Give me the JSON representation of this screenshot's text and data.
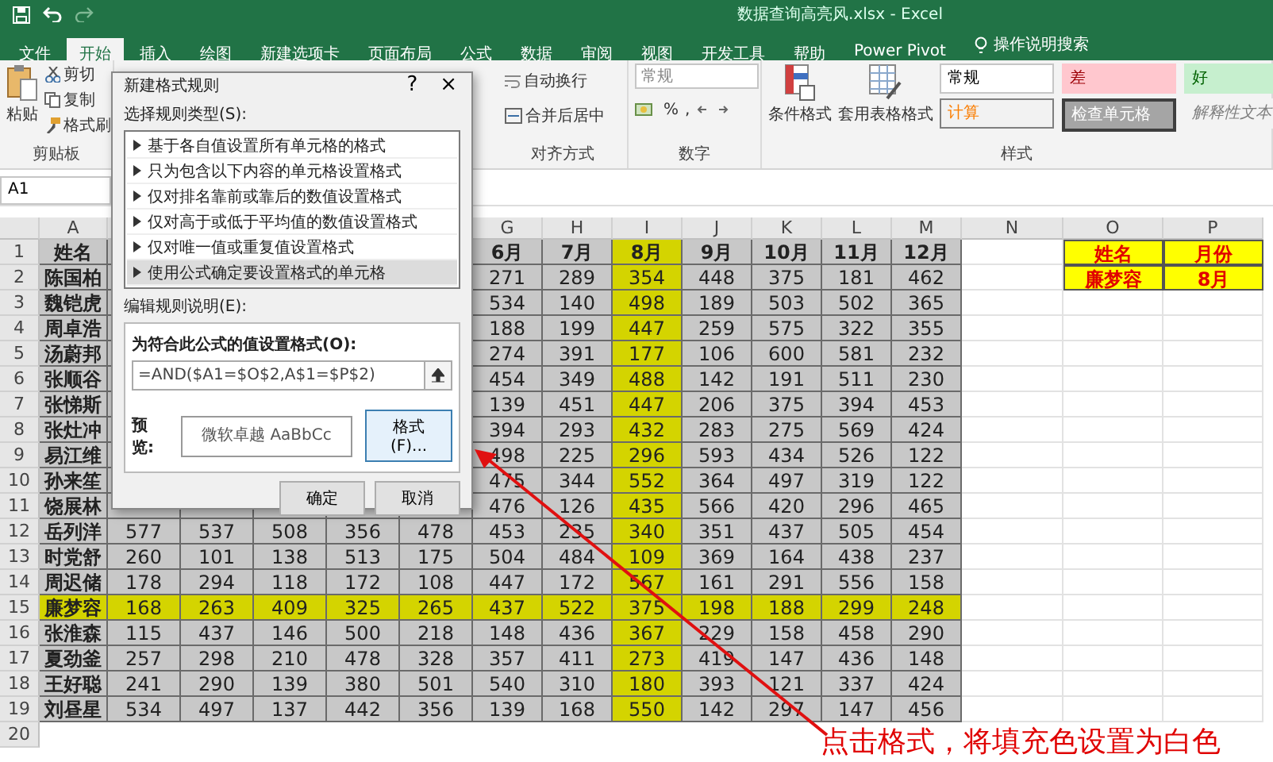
{
  "title_bar": {
    "filename": "数据查询高亮风.xlsx - Excel"
  },
  "tabs": [
    {
      "label": "文件",
      "selected": false
    },
    {
      "label": "开始",
      "selected": true
    },
    {
      "label": "插入",
      "selected": false
    },
    {
      "label": "绘图",
      "selected": false
    },
    {
      "label": "新建选项卡",
      "selected": false
    },
    {
      "label": "页面布局",
      "selected": false
    },
    {
      "label": "公式",
      "selected": false
    },
    {
      "label": "数据",
      "selected": false
    },
    {
      "label": "审阅",
      "selected": false
    },
    {
      "label": "视图",
      "selected": false
    },
    {
      "label": "开发工具",
      "selected": false
    },
    {
      "label": "帮助",
      "selected": false
    },
    {
      "label": "Power Pivot",
      "selected": false
    }
  ],
  "tell_me": "操作说明搜索",
  "ribbon": {
    "clipboard": {
      "paste": "粘贴",
      "cut": "剪切",
      "copy": "复制",
      "format_painter": "格式刷",
      "label": "剪贴板"
    },
    "alignment": {
      "wrap": "自动换行",
      "merge": "合并后居中",
      "label": "对齐方式"
    },
    "number": {
      "format": "常规",
      "percent": "%",
      "comma": ",",
      "label": "数字"
    },
    "styles": {
      "conditional": "条件格式",
      "table": "套用表格格式",
      "label": "样式",
      "cell_styles": [
        {
          "label": "常规",
          "kind": "normal"
        },
        {
          "label": "差",
          "kind": "bad"
        },
        {
          "label": "好",
          "kind": "good"
        },
        {
          "label": "计算",
          "kind": "calc"
        },
        {
          "label": "检查单元格",
          "kind": "check"
        },
        {
          "label": "解释性文本",
          "kind": "explanatory"
        }
      ]
    }
  },
  "name_box": "A1",
  "sheet": {
    "column_letters": [
      "A",
      "G",
      "H",
      "I",
      "J",
      "K",
      "L",
      "M",
      "N",
      "O",
      "P"
    ],
    "rows": [
      {
        "number": "1",
        "highlighted": false,
        "name": "姓名",
        "headers": [
          {
            "label": "6月",
            "highlighted": false
          },
          {
            "label": "7月",
            "highlighted": false
          },
          {
            "label": "8月",
            "highlighted": true
          },
          {
            "label": "9月",
            "highlighted": false
          },
          {
            "label": "10月",
            "highlighted": false
          },
          {
            "label": "11月",
            "highlighted": false
          },
          {
            "label": "12月",
            "highlighted": false
          }
        ],
        "lookup": [
          "姓名",
          "月份"
        ]
      },
      {
        "number": "2",
        "highlighted": false,
        "name": "陈国柏",
        "values": [
          "271",
          "289",
          "354",
          "448",
          "375",
          "181",
          "462"
        ],
        "lookup": [
          "廉梦容",
          "8月"
        ]
      },
      {
        "number": "3",
        "highlighted": false,
        "name": "魏铠虎",
        "values": [
          "534",
          "140",
          "498",
          "189",
          "503",
          "502",
          "365"
        ]
      },
      {
        "number": "4",
        "highlighted": false,
        "name": "周卓浩",
        "values": [
          "188",
          "199",
          "447",
          "259",
          "575",
          "322",
          "355"
        ]
      },
      {
        "number": "5",
        "highlighted": false,
        "name": "汤蔚邦",
        "values": [
          "274",
          "391",
          "177",
          "106",
          "600",
          "581",
          "232"
        ]
      },
      {
        "number": "6",
        "highlighted": false,
        "name": "张顺谷",
        "values": [
          "454",
          "349",
          "488",
          "142",
          "191",
          "511",
          "230"
        ]
      },
      {
        "number": "7",
        "highlighted": false,
        "name": "张悌斯",
        "values": [
          "139",
          "451",
          "447",
          "206",
          "375",
          "394",
          "453"
        ]
      },
      {
        "number": "8",
        "highlighted": false,
        "name": "张灶冲",
        "values": [
          "394",
          "293",
          "432",
          "283",
          "275",
          "569",
          "424"
        ]
      },
      {
        "number": "9",
        "highlighted": false,
        "name": "易江维",
        "values": [
          "498",
          "225",
          "296",
          "593",
          "434",
          "526",
          "122"
        ]
      },
      {
        "number": "10",
        "highlighted": false,
        "name": "孙来笙",
        "values": [
          "475",
          "344",
          "552",
          "364",
          "497",
          "319",
          "122"
        ]
      },
      {
        "number": "11",
        "highlighted": false,
        "name": "饶展林",
        "values": [
          "476",
          "126",
          "435",
          "566",
          "420",
          "296",
          "465"
        ]
      },
      {
        "number": "12",
        "highlighted": false,
        "name": "岳列洋",
        "values": [
          "577",
          "537",
          "508",
          "356",
          "478",
          "453",
          "235",
          "340",
          "351",
          "437",
          "505",
          "454"
        ]
      },
      {
        "number": "13",
        "highlighted": false,
        "name": "时党舒",
        "values": [
          "260",
          "101",
          "138",
          "513",
          "175",
          "504",
          "484",
          "109",
          "369",
          "164",
          "438",
          "237"
        ]
      },
      {
        "number": "14",
        "highlighted": false,
        "name": "周迟储",
        "values": [
          "178",
          "294",
          "118",
          "172",
          "108",
          "447",
          "172",
          "567",
          "161",
          "291",
          "556",
          "158"
        ]
      },
      {
        "number": "15",
        "highlighted": true,
        "name": "廉梦容",
        "values": [
          "168",
          "263",
          "409",
          "325",
          "265",
          "437",
          "522",
          "375",
          "198",
          "188",
          "299",
          "248"
        ]
      },
      {
        "number": "16",
        "highlighted": false,
        "name": "张淮森",
        "values": [
          "115",
          "437",
          "146",
          "500",
          "218",
          "148",
          "436",
          "367",
          "229",
          "158",
          "458",
          "290"
        ]
      },
      {
        "number": "17",
        "highlighted": false,
        "name": "夏劲釜",
        "values": [
          "257",
          "298",
          "210",
          "478",
          "328",
          "357",
          "411",
          "273",
          "419",
          "147",
          "436",
          "148"
        ]
      },
      {
        "number": "18",
        "highlighted": false,
        "name": "王好聪",
        "values": [
          "241",
          "290",
          "139",
          "380",
          "501",
          "540",
          "310",
          "180",
          "393",
          "121",
          "337",
          "424"
        ]
      },
      {
        "number": "19",
        "highlighted": false,
        "name": "刘昼星",
        "values": [
          "534",
          "497",
          "137",
          "442",
          "356",
          "139",
          "168",
          "550",
          "142",
          "297",
          "147",
          "456"
        ]
      }
    ],
    "next_row_number": "20"
  },
  "dialog": {
    "title": "新建格式规则",
    "help": "?",
    "close": "×",
    "rule_type_label": "选择规则类型(S):",
    "rule_types": [
      {
        "label": "基于各自值设置所有单元格的格式",
        "selected": false
      },
      {
        "label": "只为包含以下内容的单元格设置格式",
        "selected": false
      },
      {
        "label": "仅对排名靠前或靠后的数值设置格式",
        "selected": false
      },
      {
        "label": "仅对高于或低于平均值的数值设置格式",
        "selected": false
      },
      {
        "label": "仅对唯一值或重复值设置格式",
        "selected": false
      },
      {
        "label": "使用公式确定要设置格式的单元格",
        "selected": true
      }
    ],
    "edit_label": "编辑规则说明(E):",
    "formula_label": "为符合此公式的值设置格式(O):",
    "formula": "=AND($A1=$O$2,A$1=$P$2)",
    "preview_label": "预览:",
    "preview_text": "微软卓越 AaBbCc",
    "format_button": "格式(F)...",
    "ok": "确定",
    "cancel": "取消"
  },
  "annotation": "点击格式，将填充色设置为白色"
}
